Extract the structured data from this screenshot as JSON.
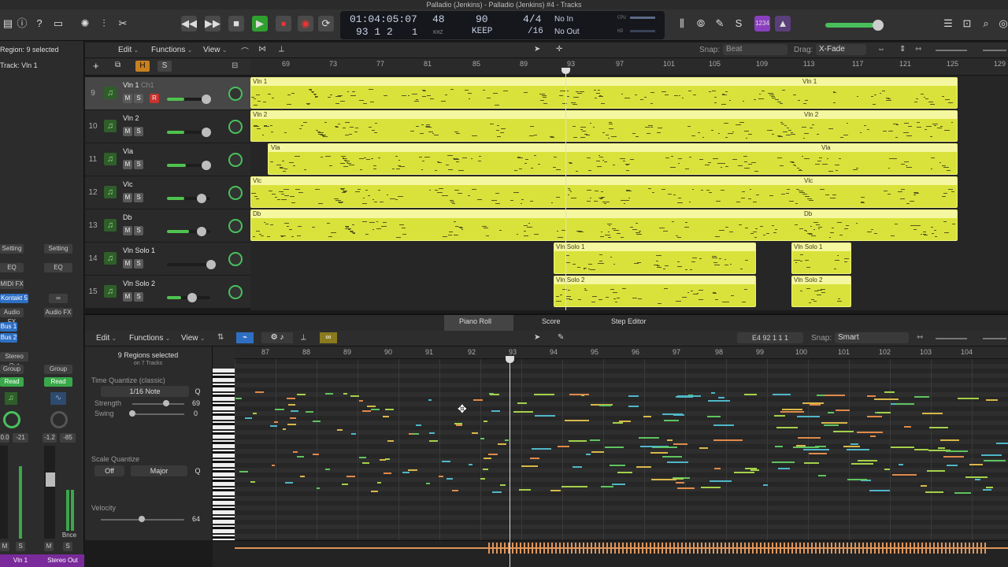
{
  "window": {
    "title": "Palladio (Jenkins) - Palladio (Jenkins) #4 - Tracks"
  },
  "lcd": {
    "time": "01:04:05:07",
    "bars": "93  1  2",
    "bars2": "1",
    "tempo_top": "48",
    "tempo_unit": "KHZ",
    "bpm": "90",
    "keep": "KEEP",
    "sig": "4/4",
    "div": "/16",
    "in": "No In",
    "out": "No Out",
    "cpu": "CPU",
    "hd": "HD",
    "count": "1234"
  },
  "inspector": {
    "region": "Region: 9 selected",
    "track": "Track:  Vln 1",
    "setting": "Setting",
    "eq": "EQ",
    "midi_fx": "MIDI FX",
    "audio_fx": "Audio FX",
    "instrument": "Kontakt 5",
    "bus1": "Bus 1",
    "bus2": "Bus 2",
    "output": "Stereo Out",
    "group": "Group",
    "read": "Read",
    "vol_left": "0.0",
    "peak_left": "-21",
    "vol_right": "-1.2",
    "peak_right": "-85",
    "bnce": "Bnce",
    "strip1_name": "Vln 1",
    "strip2_name": "Stereo Out"
  },
  "tracks_toolbar": {
    "edit": "Edit",
    "functions": "Functions",
    "view": "View",
    "snap_label": "Snap:",
    "snap_value": "Beat",
    "drag_label": "Drag:",
    "drag_value": "X-Fade"
  },
  "ruler": {
    "bars": [
      "69",
      "73",
      "77",
      "81",
      "85",
      "89",
      "93",
      "97",
      "101",
      "105",
      "109",
      "113",
      "117",
      "121",
      "125",
      "129"
    ]
  },
  "tracks": [
    {
      "num": "9",
      "name": "Vln 1",
      "chan": "Ch1",
      "region": "Vln 1",
      "region2": "Vln 1",
      "rec": "R",
      "m": "M",
      "s": "S",
      "vol": 0.8
    },
    {
      "num": "10",
      "name": "Vln 2",
      "region": "Vln 2",
      "region2": "Vln 2",
      "m": "M",
      "s": "S",
      "vol": 0.4
    },
    {
      "num": "11",
      "name": "Vla",
      "region": "Vla",
      "region2": "Vla",
      "m": "M",
      "s": "S",
      "vol": 0.45
    },
    {
      "num": "12",
      "name": "Vlc",
      "region": "Vlc",
      "region2": "Vlc",
      "m": "M",
      "s": "S",
      "vol": 0.4
    },
    {
      "num": "13",
      "name": "Db",
      "region": "Db",
      "region2": "Db",
      "m": "M",
      "s": "S",
      "vol": 0.55
    },
    {
      "num": "14",
      "name": "Vln Solo 1",
      "region": "Vln Solo 1",
      "region2": "Vln Solo 1",
      "m": "M",
      "s": "S",
      "vol": 0.0
    },
    {
      "num": "15",
      "name": "Vln Solo 2",
      "region": "Vln Solo 2",
      "region2": "Vln Solo 2",
      "m": "M",
      "s": "S",
      "vol": 0.35
    }
  ],
  "editor_tabs": {
    "piano": "Piano Roll",
    "score": "Score",
    "step": "Step Editor"
  },
  "piano_toolbar": {
    "edit": "Edit",
    "functions": "Functions",
    "view": "View",
    "position": "E4   92 1 1 1",
    "snap_label": "Snap:",
    "snap_value": "Smart"
  },
  "piano_left": {
    "selected": "9 Regions selected",
    "sub": "on 7 Tracks",
    "tq_label": "Time Quantize (classic)",
    "tq_value": "1/16 Note",
    "q": "Q",
    "strength_label": "Strength",
    "strength_value": "69",
    "swing_label": "Swing",
    "swing_value": "0",
    "sq_label": "Scale Quantize",
    "sq_off": "Off",
    "sq_major": "Major",
    "vel_label": "Velocity",
    "vel_value": "64"
  },
  "piano_ruler": {
    "bars": [
      "87",
      "88",
      "89",
      "90",
      "91",
      "92",
      "93",
      "94",
      "95",
      "96",
      "97",
      "98",
      "99",
      "100",
      "101",
      "102",
      "103",
      "104"
    ]
  },
  "colors": {
    "region": "#d9e23a",
    "accent": "#4fc24f",
    "play": "#2fa02f"
  }
}
